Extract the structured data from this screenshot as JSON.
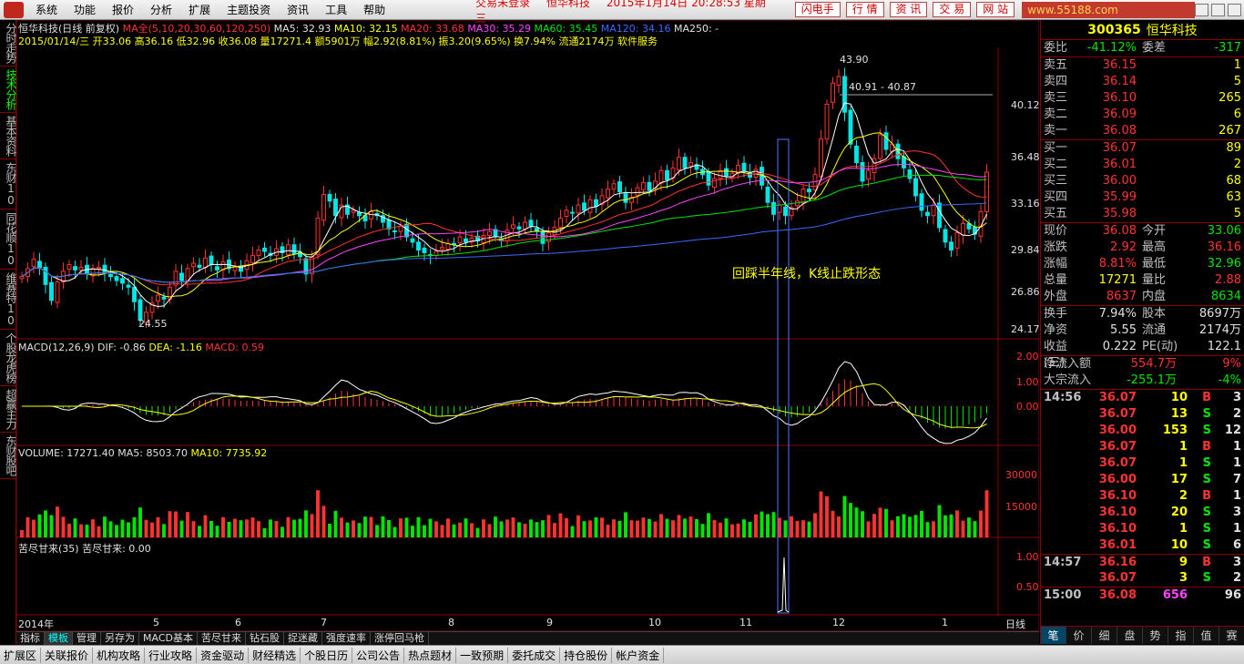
{
  "menu": {
    "items": [
      "系统",
      "功能",
      "报价",
      "分析",
      "扩展",
      "主题投资",
      "资讯",
      "工具",
      "帮助"
    ],
    "login_status": "交易未登录",
    "stock_name": "恒华科技",
    "datetime": "2015年1月14日 20:28:53 星期三",
    "right_buttons": [
      "闪电手",
      "行 情",
      "资 讯",
      "交 易",
      "网 站"
    ],
    "watermark": "www.55188.com"
  },
  "left_tabs": [
    "分时走势",
    "技术分析",
    "基本资料",
    "东财10",
    "同花顺10",
    "维赛特10",
    "个股龙虎榜",
    "超赢主力",
    "东财股吧"
  ],
  "header": {
    "title": "恒华科技(日线 前复权)",
    "ma_label": "MA全(5,10,20,30,60,120,250)",
    "ma5": "MA5: 32.93",
    "ma10": "MA10: 32.15",
    "ma20": "MA20: 33.68",
    "ma30": "MA30: 35.29",
    "ma60": "MA60: 35.45",
    "ma120": "MA120: 34.16",
    "ma250": "MA250: -",
    "line2": "2015/01/14/三 开33.06 高36.16 低32.96 收36.08 量17271.4 额5901万 幅2.92(8.81%) 振3.20(9.65%) 换7.94% 流通2174万 软件服务"
  },
  "annotations": {
    "high": "43.90",
    "range": "40.91 - 40.87",
    "low": "24.55",
    "comment": "回踩半年线，K线止跌形态"
  },
  "price_axis": [
    "40.12",
    "36.48",
    "33.16",
    "29.84",
    "26.86",
    "24.17"
  ],
  "macd": {
    "title": "MACD(12,26,9)",
    "dif": "DIF: -0.86",
    "dea": "DEA: -1.16",
    "macd": "MACD: 0.59",
    "axis": [
      "2.00",
      "1.00",
      "0.00"
    ]
  },
  "volume": {
    "title": "VOLUME: 17271.40",
    "ma5": "MA5: 8503.70",
    "ma10": "MA10: 7735.92",
    "axis": [
      "30000",
      "15000"
    ]
  },
  "kujin": {
    "title": "苦尽甘来(35)",
    "value": "苦尽甘来: 0.00",
    "axis": [
      "1.00",
      "0.50"
    ]
  },
  "date_axis": [
    "2014年",
    "5",
    "6",
    "7",
    "8",
    "9",
    "10",
    "11",
    "12",
    "1"
  ],
  "period": "日线",
  "bottom_tabs": [
    "指标",
    "模板",
    "管理",
    "另存为",
    "MACD基本",
    "苦尽甘来",
    "钻石股",
    "捉迷藏",
    "强度速率",
    "涨停回马枪"
  ],
  "status_tabs": [
    "扩展区",
    "关联报价",
    "机构攻略",
    "行业攻略",
    "资金驱动",
    "财经精选",
    "个股日历",
    "公司公告",
    "热点题材",
    "一致预期",
    "委托成交",
    "持仓股份",
    "帐户资金"
  ],
  "quote": {
    "code": "300365",
    "name": "恒华科技",
    "weibi": {
      "k": "委比",
      "v": "-41.12%",
      "k2": "委差",
      "v2": "-317"
    },
    "asks": [
      {
        "k": "卖五",
        "p": "36.15",
        "v": "1"
      },
      {
        "k": "卖四",
        "p": "36.14",
        "v": "5"
      },
      {
        "k": "卖三",
        "p": "36.10",
        "v": "265"
      },
      {
        "k": "卖二",
        "p": "36.09",
        "v": "6"
      },
      {
        "k": "卖一",
        "p": "36.08",
        "v": "267"
      }
    ],
    "bids": [
      {
        "k": "买一",
        "p": "36.07",
        "v": "89"
      },
      {
        "k": "买二",
        "p": "36.01",
        "v": "2"
      },
      {
        "k": "买三",
        "p": "36.00",
        "v": "68"
      },
      {
        "k": "买四",
        "p": "35.99",
        "v": "63"
      },
      {
        "k": "买五",
        "p": "35.98",
        "v": "5"
      }
    ],
    "stats": [
      {
        "k": "现价",
        "v": "36.08",
        "k2": "今开",
        "v2": "33.06"
      },
      {
        "k": "涨跌",
        "v": "2.92",
        "k2": "最高",
        "v2": "36.16"
      },
      {
        "k": "涨幅",
        "v": "8.81%",
        "k2": "最低",
        "v2": "32.96"
      },
      {
        "k": "总量",
        "v": "17271",
        "k2": "量比",
        "v2": "2.88"
      },
      {
        "k": "外盘",
        "v": "8637",
        "k2": "内盘",
        "v2": "8634"
      }
    ],
    "stats2": [
      {
        "k": "换手",
        "v": "7.94%",
        "k2": "股本",
        "v2": "8697万"
      },
      {
        "k": "净资",
        "v": "5.55",
        "k2": "流通",
        "v2": "2174万"
      },
      {
        "k": "收益(三)",
        "v": "0.222",
        "k2": "PE(动)",
        "v2": "122.1"
      }
    ],
    "flow": [
      {
        "k": "净流入额",
        "v": "554.7万",
        "p": "9%"
      },
      {
        "k": "大宗流入",
        "v": "-255.1万",
        "p": "-4%"
      }
    ],
    "ticks": [
      {
        "t": "14:56",
        "p": "36.07",
        "v": "10",
        "bs": "B",
        "n": "3"
      },
      {
        "t": "",
        "p": "36.07",
        "v": "13",
        "bs": "S",
        "n": "2"
      },
      {
        "t": "",
        "p": "36.00",
        "v": "153",
        "bs": "S",
        "n": "12"
      },
      {
        "t": "",
        "p": "36.07",
        "v": "1",
        "bs": "B",
        "n": "1"
      },
      {
        "t": "",
        "p": "36.07",
        "v": "1",
        "bs": "S",
        "n": "1"
      },
      {
        "t": "",
        "p": "36.00",
        "v": "17",
        "bs": "S",
        "n": "7"
      },
      {
        "t": "",
        "p": "36.10",
        "v": "2",
        "bs": "B",
        "n": "1"
      },
      {
        "t": "",
        "p": "36.10",
        "v": "20",
        "bs": "S",
        "n": "3"
      },
      {
        "t": "",
        "p": "36.10",
        "v": "1",
        "bs": "S",
        "n": "1"
      },
      {
        "t": "",
        "p": "36.01",
        "v": "10",
        "bs": "S",
        "n": "6"
      },
      {
        "t": "14:57",
        "p": "36.16",
        "v": "9",
        "bs": "B",
        "n": "3"
      },
      {
        "t": "",
        "p": "36.07",
        "v": "3",
        "bs": "S",
        "n": "2"
      },
      {
        "t": "15:00",
        "p": "36.08",
        "v": "656",
        "bs": "",
        "n": "96"
      }
    ],
    "right_tabs": [
      "笔",
      "价",
      "细",
      "盘",
      "势",
      "指",
      "值",
      "赛"
    ]
  },
  "chart_data": {
    "type": "candlestick",
    "price_range": [
      23.5,
      45.5
    ],
    "closes": [
      28.2,
      28.8,
      29.5,
      28.9,
      27.6,
      26.4,
      27.8,
      28.6,
      29.1,
      28.7,
      28.9,
      28.4,
      28.8,
      28.9,
      28.5,
      28.2,
      27.9,
      27.7,
      27.4,
      26.3,
      24.9,
      25.5,
      26.2,
      26.8,
      26.5,
      27.4,
      28.6,
      27.9,
      28.8,
      29.2,
      28.9,
      29.6,
      29.1,
      28.7,
      29.3,
      28.8,
      29.0,
      28.6,
      29.4,
      29.8,
      30.2,
      30.1,
      29.8,
      30.3,
      30.0,
      30.6,
      29.9,
      29.7,
      28.4,
      29.7,
      32.6,
      34.4,
      33.9,
      32.8,
      33.6,
      32.9,
      33.2,
      32.8,
      32.4,
      33.1,
      32.8,
      32.3,
      31.8,
      31.6,
      32.0,
      31.2,
      30.8,
      30.2,
      30.0,
      29.8,
      30.1,
      30.4,
      30.7,
      30.6,
      31.2,
      30.8,
      31.1,
      30.9,
      31.3,
      31.6,
      31.2,
      30.9,
      31.7,
      32.1,
      31.8,
      32.3,
      32.0,
      31.6,
      30.7,
      31.5,
      31.9,
      32.6,
      33.2,
      33.0,
      33.6,
      33.2,
      34.0,
      33.5,
      34.3,
      34.8,
      35.2,
      34.6,
      33.8,
      34.2,
      34.9,
      35.3,
      34.7,
      35.4,
      36.2,
      35.5,
      36.4,
      37.2,
      36.4,
      36.8,
      36.3,
      35.9,
      35.1,
      35.6,
      36.2,
      35.8,
      36.0,
      36.6,
      36.2,
      35.7,
      36.3,
      35.1,
      33.8,
      32.9,
      33.6,
      32.8,
      33.4,
      33.9,
      34.8,
      34.6,
      35.9,
      38.6,
      41.2,
      42.8,
      43.3,
      40.6,
      38.2,
      36.8,
      35.4,
      36.2,
      37.1,
      38.9,
      37.8,
      38.2,
      37.1,
      36.4,
      35.6,
      34.3,
      33.2,
      32.8,
      33.6,
      31.9,
      30.8,
      30.2,
      31.5,
      32.2,
      31.8,
      31.4,
      33.1,
      36.08
    ]
  }
}
